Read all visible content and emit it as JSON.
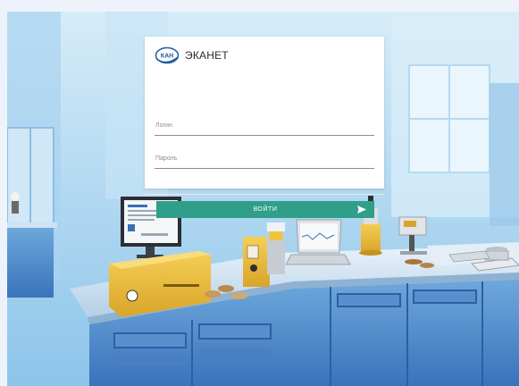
{
  "brand": {
    "logo_text": "КАН",
    "name": "ЭКАНЕТ"
  },
  "form": {
    "login_placeholder": "Логин",
    "login_value": "",
    "password_placeholder": "Пароль",
    "password_value": "",
    "submit_label": "ВОЙТИ"
  },
  "colors": {
    "submit_button": "#2f9f89",
    "logo_blue": "#1f5ba8",
    "page_background": "#eef3fb"
  },
  "icons": {
    "submit": "send-arrow-icon",
    "logo": "kan-logo-icon"
  }
}
